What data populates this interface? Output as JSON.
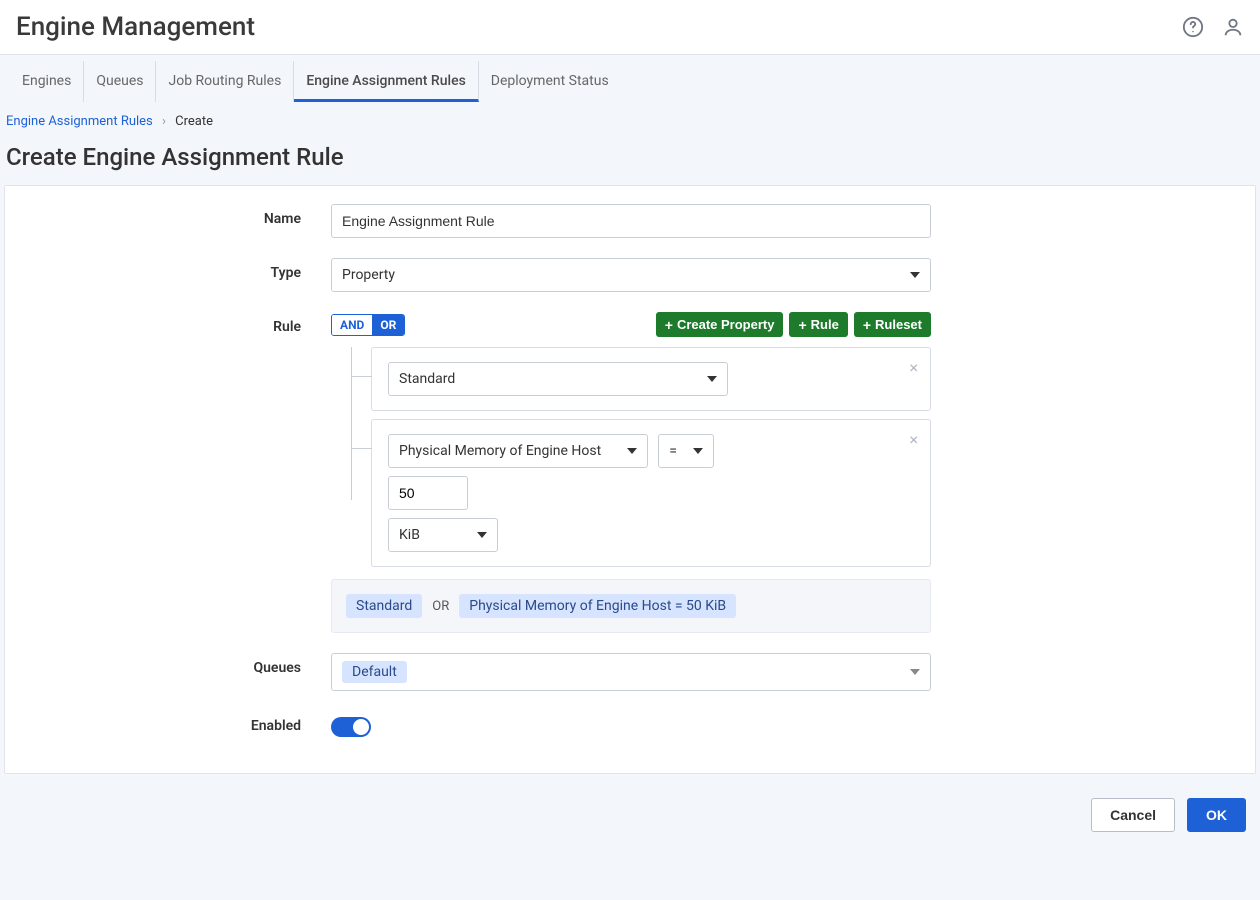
{
  "header": {
    "title": "Engine Management"
  },
  "tabs": [
    {
      "label": "Engines",
      "active": false
    },
    {
      "label": "Queues",
      "active": false
    },
    {
      "label": "Job Routing Rules",
      "active": false
    },
    {
      "label": "Engine Assignment Rules",
      "active": true
    },
    {
      "label": "Deployment Status",
      "active": false
    }
  ],
  "breadcrumb": {
    "parent": "Engine Assignment Rules",
    "current": "Create"
  },
  "page_title": "Create Engine Assignment Rule",
  "form": {
    "name_label": "Name",
    "name_value": "Engine Assignment Rule",
    "type_label": "Type",
    "type_value": "Property",
    "rule_label": "Rule",
    "logic": {
      "and": "AND",
      "or": "OR"
    },
    "buttons": {
      "create_property": "Create Property",
      "rule": "Rule",
      "ruleset": "Ruleset"
    },
    "rule1": {
      "select": "Standard"
    },
    "rule2": {
      "property": "Physical Memory of Engine Host",
      "operator": "=",
      "value": "50",
      "unit": "KiB"
    },
    "summary": {
      "term1": "Standard",
      "op": "OR",
      "term2": "Physical Memory of Engine Host = 50 KiB"
    },
    "queues_label": "Queues",
    "queues_value": "Default",
    "enabled_label": "Enabled"
  },
  "footer": {
    "cancel": "Cancel",
    "ok": "OK"
  }
}
